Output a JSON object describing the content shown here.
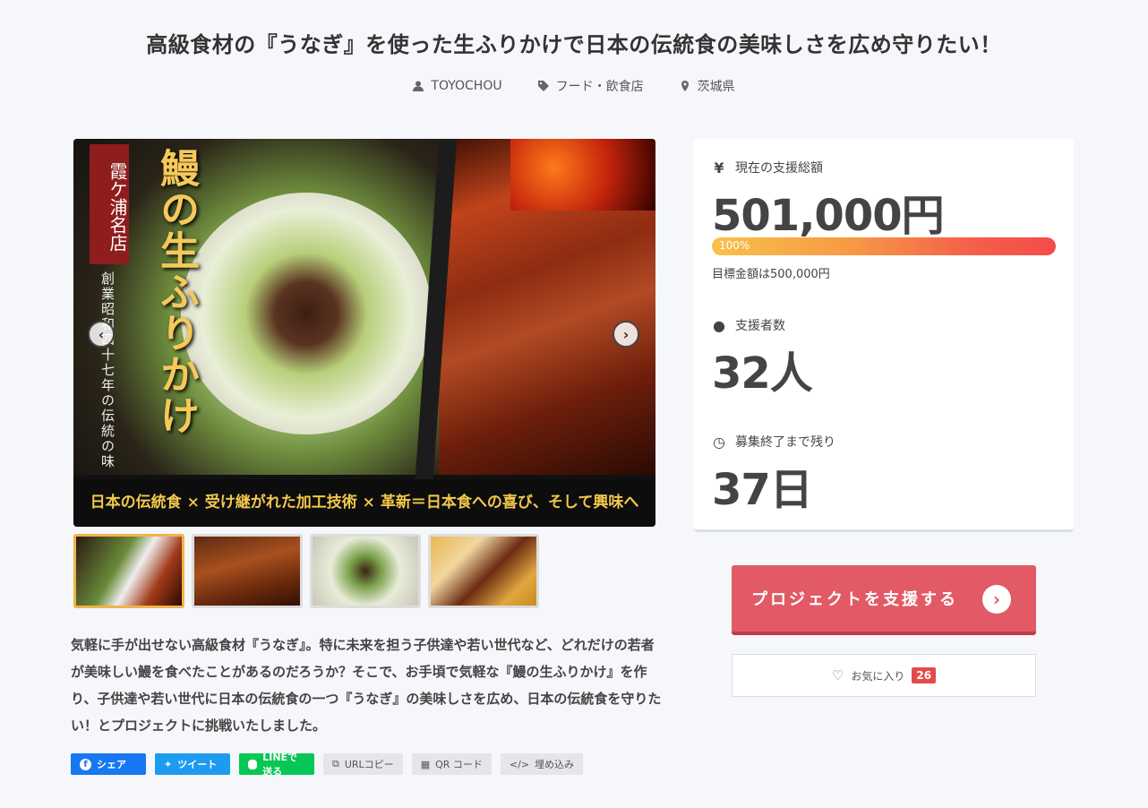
{
  "header": {
    "title": "高級食材の『うなぎ』を使った生ふりかけで日本の伝統食の美味しさを広め守りたい！",
    "owner": "TOYOCHOU",
    "category": "フード・飲食店",
    "location": "茨城県"
  },
  "hero": {
    "badge_text": "霞ケ浦名店",
    "sub_text": "創業昭和四十七年の伝統の味",
    "main_text": "鰻の生ふりかけ",
    "caption": "日本の伝統食 × 受け継がれた加工技術 × 革新＝日本食への喜び、そして興味へ"
  },
  "description": "気軽に手が出せない高級食材『うなぎ』。特に未来を担う子供達や若い世代など、どれだけの若者が美味しい鰻を食べたことがあるのだろうか？そこで、お手頃で気軽な『鰻の生ふりかけ』を作り、子供達や若い世代に日本の伝統食の一つ『うなぎ』の美味しさを広め、日本の伝統食を守りたい！とプロジェクトに挑戦いたしました。",
  "share": {
    "facebook": "シェア",
    "twitter": "ツイート",
    "line": "LINEで送る",
    "copy_url": "URLコピー",
    "qr": "QR コード",
    "embed": "埋め込み"
  },
  "stats": {
    "amount_label": "現在の支援総額",
    "amount_value": "501,000円",
    "progress_label": "100%",
    "progress_fraction": 1.0,
    "goal_text": "目標金額は500,000円",
    "backers_label": "支援者数",
    "backers_value": "32人",
    "remaining_label": "募集終了まで残り",
    "remaining_value": "37日"
  },
  "actions": {
    "support_label": "プロジェクトを支援する",
    "favorite_label": "お気に入り",
    "favorite_count": "26"
  }
}
